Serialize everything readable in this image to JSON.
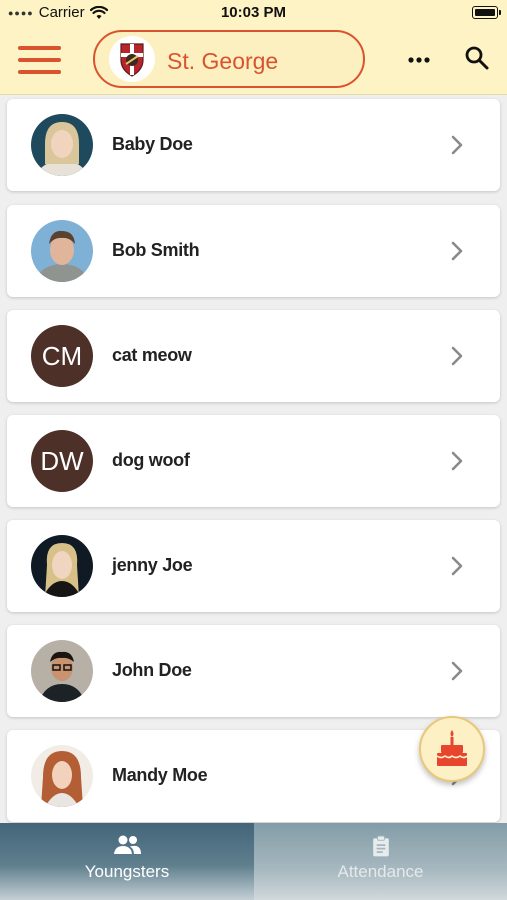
{
  "status_bar": {
    "carrier": "Carrier",
    "time": "10:03 PM"
  },
  "header": {
    "school_name": "St. George"
  },
  "students": [
    {
      "name": "Baby Doe",
      "avatar": "photo"
    },
    {
      "name": "Bob Smith",
      "avatar": "photo"
    },
    {
      "name": "cat meow",
      "avatar": "initials",
      "initials": "CM"
    },
    {
      "name": "dog woof",
      "avatar": "initials",
      "initials": "DW"
    },
    {
      "name": "jenny Joe",
      "avatar": "photo"
    },
    {
      "name": "John Doe",
      "avatar": "photo"
    },
    {
      "name": "Mandy Moe",
      "avatar": "photo"
    }
  ],
  "tabs": [
    {
      "label": "Youngsters",
      "icon": "people-icon",
      "active": true
    },
    {
      "label": "Attendance",
      "icon": "clipboard-icon",
      "active": false
    }
  ],
  "colors": {
    "accent": "#d9532f",
    "header_bg": "#fdf3c4",
    "initials_bg": "#4d3028"
  }
}
